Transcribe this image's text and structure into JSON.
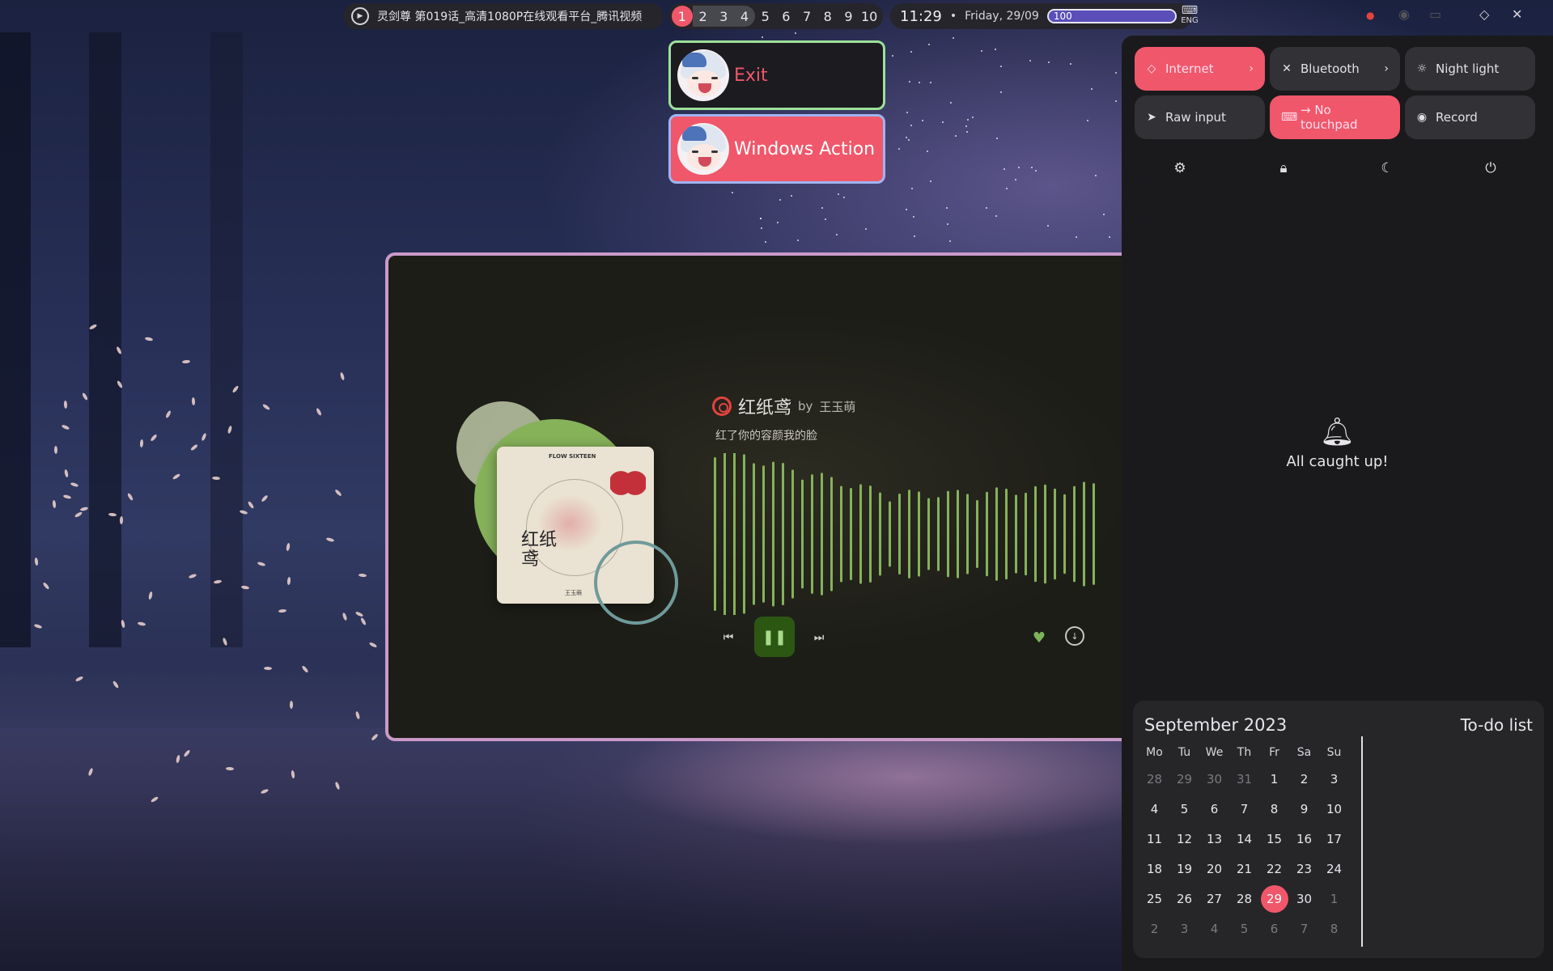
{
  "topbar": {
    "media_title": "灵剑尊 第019话_高清1080P在线观看平台_腾讯视频",
    "media_icon": "play-circle-icon",
    "workspaces": [
      "1",
      "2",
      "3",
      "4",
      "5",
      "6",
      "7",
      "8",
      "9",
      "10"
    ],
    "active_workspace": "1",
    "time": "11:29",
    "separator": "•",
    "date": "Friday, 29/09",
    "battery_level": "100",
    "keyboard_layout": "ENG",
    "tray_icons": [
      "app-tray-icon",
      "record-tray-icon",
      "keyboard-tray-icon",
      "wifi-icon",
      "bluetooth-off-icon"
    ]
  },
  "power_menu": {
    "exit_label": "Exit",
    "windows_action_label": "Windows Action"
  },
  "player": {
    "title": "红纸鸢",
    "by_label": "by",
    "artist": "王玉萌",
    "lyric": "红了你的容颜我的脸",
    "cover_brand": "FLOW SIXTEEN",
    "cover_text": "红纸鸢",
    "cover_sub": "王玉萌",
    "accent": "#86b25a",
    "play_state_icon": "pause-icon"
  },
  "sidebar": {
    "toggles": [
      {
        "label": "Internet",
        "icon": "wifi-icon",
        "on": true,
        "chevron": "›"
      },
      {
        "label": "Bluetooth",
        "icon": "bluetooth-off-icon",
        "on": false,
        "chevron": "›"
      },
      {
        "label": "Night light",
        "icon": "sun-icon",
        "on": false
      },
      {
        "label": "Raw input",
        "icon": "cursor-icon",
        "on": false
      },
      {
        "label": "→ No touchpad",
        "icon": "keyboard-icon",
        "on": true
      },
      {
        "label": "Record",
        "icon": "record-icon",
        "on": false
      }
    ],
    "system_icons": [
      "settings-gear-icon",
      "lock-icon",
      "moon-icon",
      "power-icon"
    ],
    "notifications_message": "All caught up!",
    "accent": "#f0576a"
  },
  "calendar": {
    "title": "September 2023",
    "todo_title": "To-do list",
    "weekdays": [
      "Mo",
      "Tu",
      "We",
      "Th",
      "Fr",
      "Sa",
      "Su"
    ],
    "weeks": [
      [
        "28",
        "29",
        "30",
        "31",
        "1",
        "2",
        "3"
      ],
      [
        "4",
        "5",
        "6",
        "7",
        "8",
        "9",
        "10"
      ],
      [
        "11",
        "12",
        "13",
        "14",
        "15",
        "16",
        "17"
      ],
      [
        "18",
        "19",
        "20",
        "21",
        "22",
        "23",
        "24"
      ],
      [
        "25",
        "26",
        "27",
        "28",
        "29",
        "30",
        "1"
      ],
      [
        "2",
        "3",
        "4",
        "5",
        "6",
        "7",
        "8"
      ]
    ],
    "today": "29"
  }
}
